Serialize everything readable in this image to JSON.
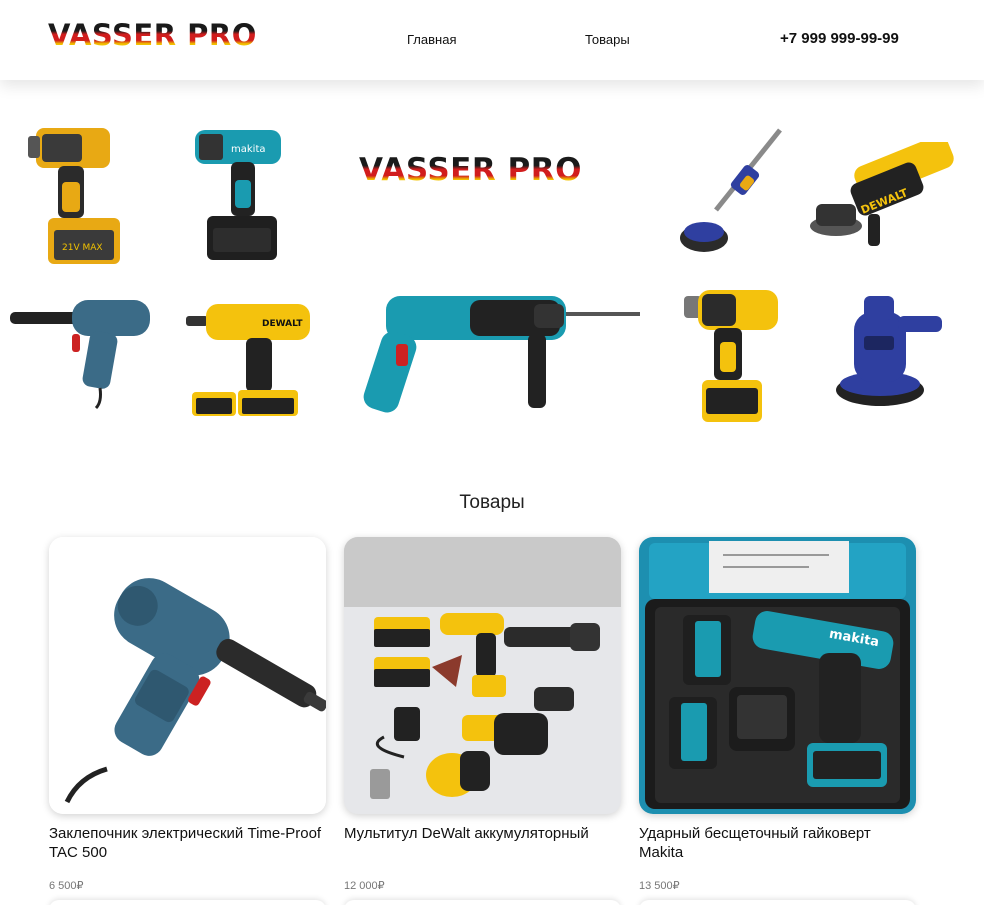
{
  "header": {
    "logo": "VASSER PRO",
    "nav": [
      {
        "label": "Главная"
      },
      {
        "label": "Товары"
      }
    ],
    "phone": "+7 999 999-99-99"
  },
  "hero": {
    "logo": "VASSER PRO",
    "tools": [
      "impact-wrench-yellow",
      "impact-wrench-makita",
      "rivet-gun",
      "drill-dewalt",
      "rotary-hammer",
      "wall-sander-pole",
      "angle-grinder-dewalt",
      "impact-wrench-dewalt",
      "wall-sander-blue"
    ]
  },
  "products": {
    "title": "Товары",
    "items": [
      {
        "name": "Заклепочник электрический Time-Proof TAC 500",
        "price": "6 500₽"
      },
      {
        "name": "Мультитул DeWalt аккумуляторный",
        "price": "12 000₽"
      },
      {
        "name": "Ударный бесщеточный гайковерт Makita",
        "price": "13 500₽"
      }
    ]
  },
  "colors": {
    "accent_red": "#d11d1d",
    "accent_yellow": "#f2c200",
    "makita_teal": "#1a9bb0",
    "dewalt_yellow": "#f4c20d"
  }
}
